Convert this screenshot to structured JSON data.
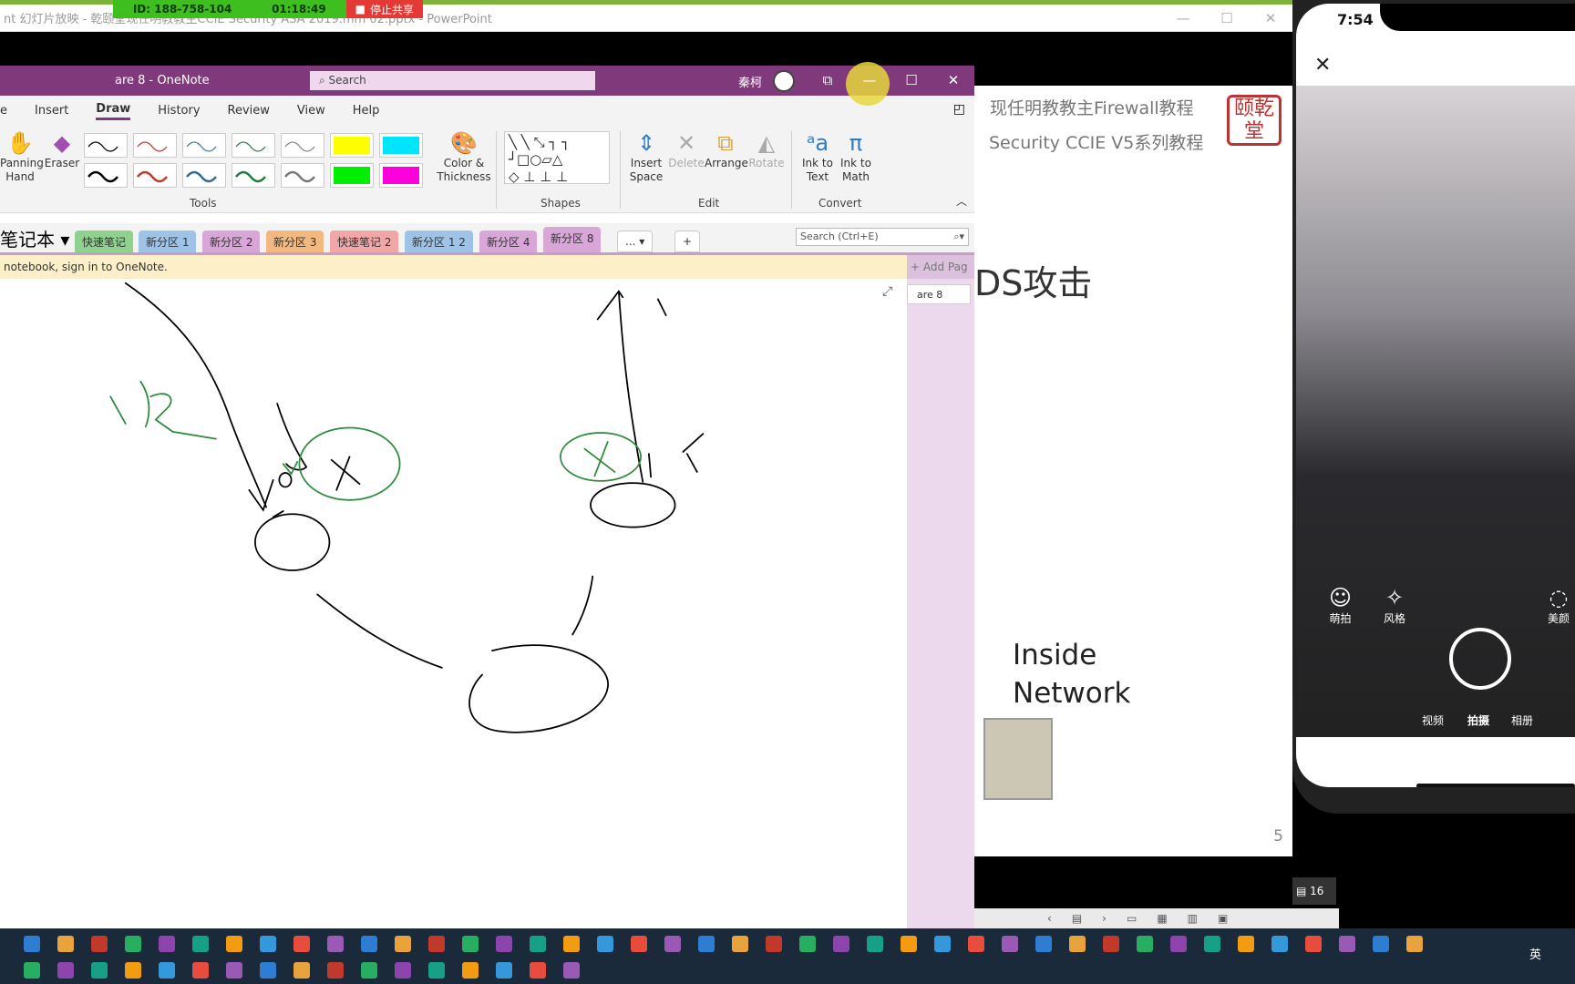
{
  "share_bar": {
    "id": "ID: 188-758-104",
    "timer": "01:18:49",
    "stop": "停止共享"
  },
  "ppt_window": {
    "title": "nt 幻灯片放映 - 乾颐堂现任明教教主CCIE Security ASA 2019.mm 02.pptx - PowerPoint",
    "minimize": "—",
    "maximize": "☐",
    "close": "✕"
  },
  "onenote": {
    "title": "are 8 - OneNote",
    "search_placeholder": "Search",
    "user": "秦柯",
    "window_controls": {
      "restore": "⧉",
      "minimize": "—",
      "maximize": "☐",
      "close": "✕"
    },
    "ribbon_tabs": [
      "e",
      "Insert",
      "Draw",
      "History",
      "Review",
      "View",
      "Help"
    ],
    "active_tab": "Draw",
    "tools": {
      "panning": "Panning Hand",
      "eraser": "Eraser",
      "color": "Color & Thickness",
      "group": "Tools"
    },
    "pens": {
      "row1": [
        "#000000",
        "#c0392b",
        "#4a7a9a",
        "#3a7a55",
        "#888888",
        "#ffff00",
        "#00e5ff"
      ],
      "row2": [
        "#000000",
        "#c0392b",
        "#2f6a94",
        "#1f7a3a",
        "#777777",
        "#00ee00",
        "#ff00dd"
      ]
    },
    "shapes_group": "Shapes",
    "edit": {
      "insert_space": "Insert Space",
      "delete": "Delete",
      "arrange": "Arrange",
      "rotate": "Rotate",
      "group": "Edit"
    },
    "convert": {
      "ink_to_text": "Ink to Text",
      "ink_to_math": "Ink to Math",
      "group": "Convert"
    },
    "notebook": "笔记本",
    "sections": [
      {
        "label": "快速笔记",
        "color": "#8fd18f"
      },
      {
        "label": "新分区 1",
        "color": "#9ec3e6"
      },
      {
        "label": "新分区 2",
        "color": "#d8a7d8"
      },
      {
        "label": "新分区 3",
        "color": "#f2b880"
      },
      {
        "label": "快速笔记 2",
        "color": "#f1a7a7"
      },
      {
        "label": "新分区 1 2",
        "color": "#9ec3e6"
      },
      {
        "label": "新分区 4",
        "color": "#d8a7d8"
      },
      {
        "label": "新分区 8",
        "color": "#d8a7d8"
      }
    ],
    "more_sections": "... ▾",
    "add_section": "+",
    "search_notebook": "Search (Ctrl+E)",
    "notice": "notebook, sign in to OneNote.",
    "add_page": "+ Add Pag",
    "page": "are 8"
  },
  "slide": {
    "line1": "现任明教教主Firewall教程",
    "line2": "Security CCIE V5系列教程",
    "heading": "DS攻击",
    "inside": "Inside",
    "network": "Network",
    "seal": "颐乾堂",
    "page_number": "5"
  },
  "ppt_status": {
    "comments": "16"
  },
  "phone": {
    "time": "7:54",
    "close": "✕",
    "modes": [
      "萌拍",
      "风格",
      "美颜"
    ],
    "bottom": [
      "视频",
      "拍摄",
      "相册"
    ]
  },
  "taskbar": {
    "ime": "英"
  }
}
